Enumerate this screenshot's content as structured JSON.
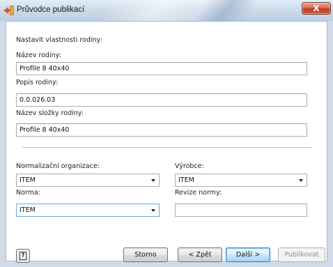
{
  "window": {
    "title": "Průvodce publikací",
    "close_glyph": "X",
    "icon": "wizard-app-icon"
  },
  "form": {
    "section_label": "Nastavit vlastnosti rodiny:",
    "family_name": {
      "label": "Název rodiny:",
      "value": "Profile 8 40x40"
    },
    "family_description": {
      "label": "Popis rodiny:",
      "value": "0.0.026.03"
    },
    "family_folder_name": {
      "label": "Název složky rodiny:",
      "value": "Profile 8 40x40"
    },
    "standards_organization": {
      "label": "Normalizační organizace:",
      "value": "ITEM"
    },
    "manufacturer": {
      "label": "Výrobce:",
      "value": "ITEM"
    },
    "standard": {
      "label": "Norma:",
      "value": "ITEM"
    },
    "standard_revision": {
      "label": "Revize normy:",
      "value": ""
    }
  },
  "buttons": {
    "help_glyph": "?",
    "cancel": "Storno",
    "back": "< Zpět",
    "next": "Další >",
    "publish": "Publikovat"
  },
  "colors": {
    "titlebar": "#cddbea",
    "close_button": "#c03a1f",
    "default_button_border": "#3c7fb1"
  }
}
